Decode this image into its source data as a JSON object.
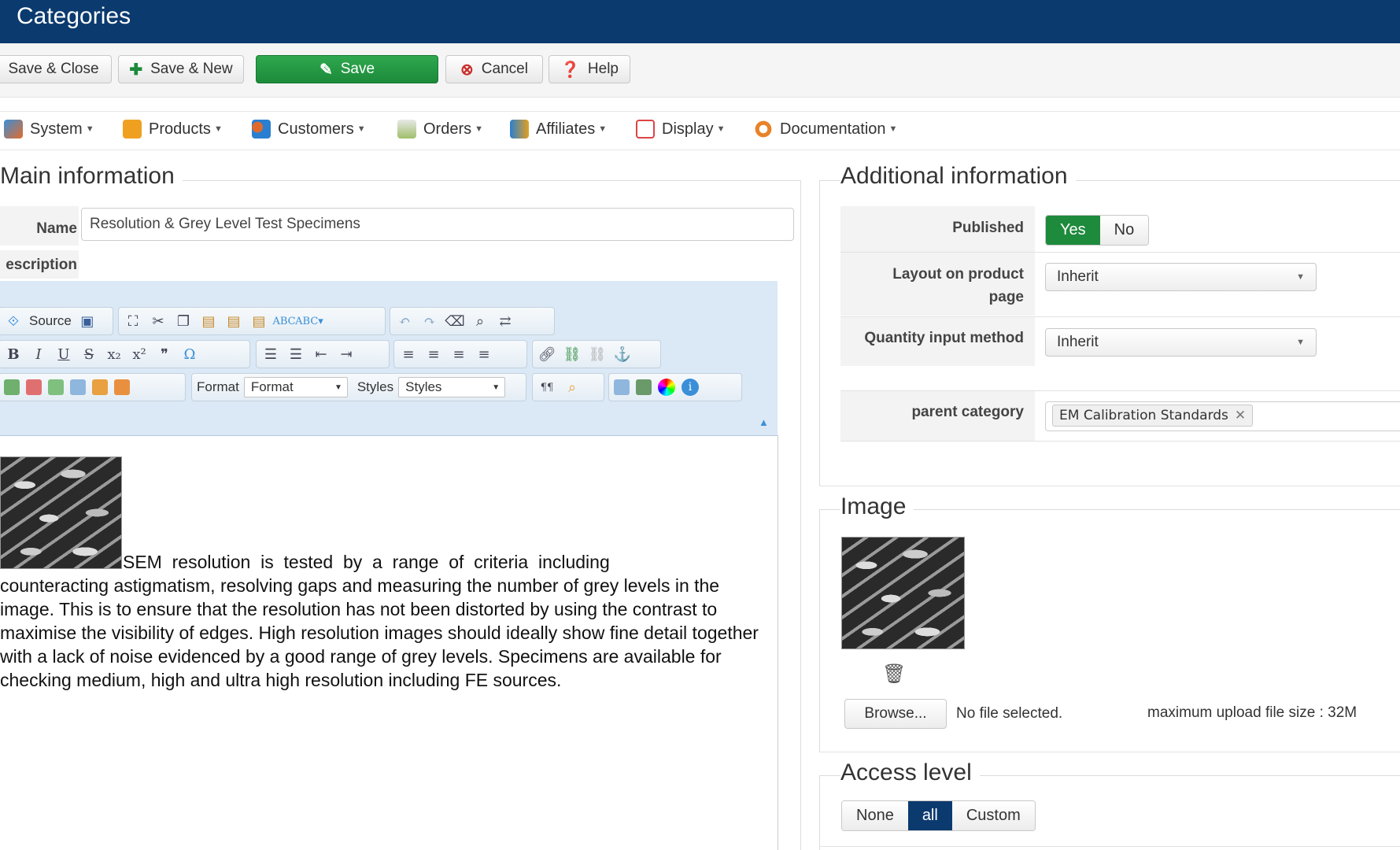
{
  "header": {
    "title": "Categories"
  },
  "toolbar": {
    "save_close": "Save & Close",
    "save_new": "Save & New",
    "save": "Save",
    "cancel": "Cancel",
    "help": "Help"
  },
  "menu": {
    "items": [
      {
        "label": "System",
        "icon": "tools-icon"
      },
      {
        "label": "Products",
        "icon": "box-icon"
      },
      {
        "label": "Customers",
        "icon": "users-icon"
      },
      {
        "label": "Orders",
        "icon": "clipboard-icon"
      },
      {
        "label": "Affiliates",
        "icon": "affiliates-icon"
      },
      {
        "label": "Display",
        "icon": "window-icon"
      },
      {
        "label": "Documentation",
        "icon": "lifebuoy-icon"
      }
    ]
  },
  "main_info": {
    "legend": "Main information",
    "name_label": "Name",
    "name_value": "Resolution & Grey Level Test Specimens",
    "description_label": "escription",
    "editor": {
      "source_label": "Source",
      "format_label": "Format",
      "format_value": "Format",
      "styles_label": "Styles",
      "styles_value": "Styles"
    },
    "content_first": "SEM  resolution  is  tested  by  a  range  of  criteria  including",
    "content_rest": "counteracting  astigmatism, resolving gaps and measuring the number of grey levels in the image. This is to ensure that the resolution has not been distorted by using the contrast to maximise the visibility of edges. High resolution images should ideally show fine detail together with a lack of noise evidenced by a good range of grey levels. Specimens are available for checking medium, high and ultra high resolution including FE sources."
  },
  "additional_info": {
    "legend": "Additional information",
    "published_label": "Published",
    "published_yes": "Yes",
    "published_no": "No",
    "published_value": "Yes",
    "layout_label_1": "Layout on product",
    "layout_label_2": "page",
    "layout_value": "Inherit",
    "qty_label": "Quantity input method",
    "qty_value": "Inherit",
    "parent_label": "parent category",
    "parent_tag": "EM Calibration Standards"
  },
  "image_section": {
    "legend": "Image",
    "browse": "Browse...",
    "no_file": "No file selected.",
    "max_size": "maximum upload file size : 32M"
  },
  "access_level": {
    "legend": "Access level",
    "options": [
      "None",
      "all",
      "Custom"
    ],
    "selected": "all"
  },
  "colors": {
    "header_bg": "#0b3a6e",
    "save_green": "#1e8a3c",
    "access_blue": "#0b3a6e"
  }
}
